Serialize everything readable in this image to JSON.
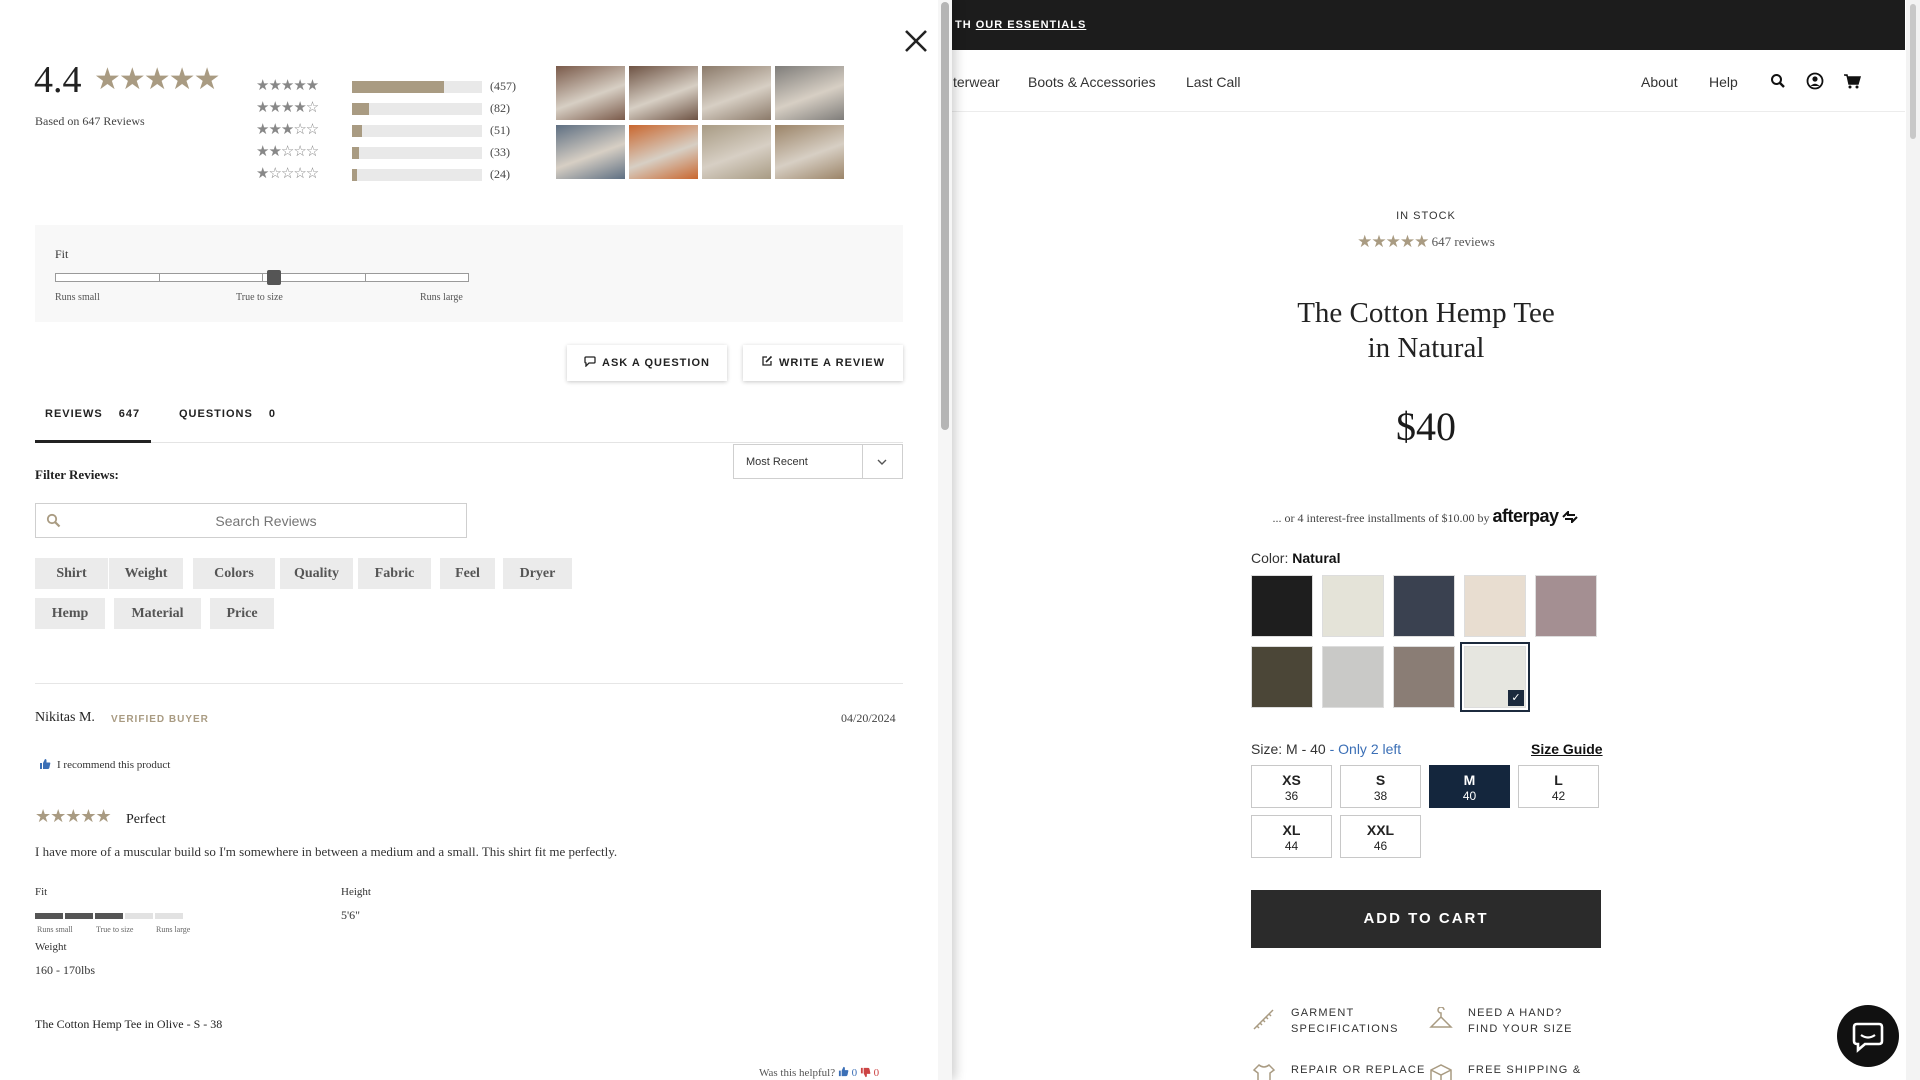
{
  "product_page": {
    "announcement": {
      "text": "TH",
      "link": "OUR ESSENTIALS"
    },
    "nav": {
      "links": [
        "terwear",
        "Boots & Accessories",
        "Last Call"
      ],
      "right_links": [
        "About",
        "Help"
      ],
      "icons": [
        "search-icon",
        "account-icon",
        "cart-icon"
      ]
    },
    "stock_status": "IN STOCK",
    "rating_stars": "★★★★★",
    "review_count_text": "647 reviews",
    "title_line1": "The Cotton Hemp Tee",
    "title_line2": "in Natural",
    "price": "$40",
    "afterpay_text": "... or 4 interest-free installments of $10.00 by",
    "afterpay_brand": "afterpay",
    "color_label": "Color:",
    "color_value": "Natural",
    "swatch_colors": [
      "#1e1e1e",
      "#e4e3d8",
      "#3a4150",
      "#e8ddd0",
      "#a48f92",
      "#4b4637",
      "#c9c9c7",
      "#8a7d75",
      "#e6e6e0"
    ],
    "selected_swatch": 8,
    "size_label": "Size: M - 40",
    "size_stock": "- Only 2 left",
    "size_guide": "Size Guide",
    "sizes": [
      {
        "label": "XS",
        "num": "36"
      },
      {
        "label": "S",
        "num": "38"
      },
      {
        "label": "M",
        "num": "40"
      },
      {
        "label": "L",
        "num": "42"
      },
      {
        "label": "XL",
        "num": "44"
      },
      {
        "label": "XXL",
        "num": "46"
      }
    ],
    "selected_size": 2,
    "add_to_cart": "ADD TO CART",
    "features": [
      {
        "line1": "GARMENT",
        "line2": "SPECIFICATIONS"
      },
      {
        "line1": "NEED A HAND?",
        "line2": "FIND YOUR SIZE"
      },
      {
        "line1": "REPAIR OR REPLACE",
        "line2": ""
      },
      {
        "line1": "FREE SHIPPING &",
        "line2": ""
      }
    ]
  },
  "reviews": {
    "average": "4.4",
    "average_stars": "★★★★★",
    "based_on": "Based on 647 Reviews",
    "distribution": [
      {
        "stars": "★★★★★",
        "count": "(457)",
        "fraction": 0.706
      },
      {
        "stars": "★★★★☆",
        "count": "(82)",
        "fraction": 0.127
      },
      {
        "stars": "★★★☆☆",
        "count": "(51)",
        "fraction": 0.079
      },
      {
        "stars": "★★☆☆☆",
        "count": "(33)",
        "fraction": 0.051
      },
      {
        "stars": "★☆☆☆☆",
        "count": "(24)",
        "fraction": 0.037
      }
    ],
    "photo_colors": [
      "#7a5a4a",
      "#6e5344",
      "#8b7a6a",
      "#7f7d7a",
      "#5e6f82",
      "#c9672f",
      "#a89b84",
      "#9b8468"
    ],
    "fit": {
      "title": "Fit",
      "value": 0.53,
      "labels": [
        "Runs small",
        "True to size",
        "Runs large"
      ]
    },
    "ask_question": "ASK A QUESTION",
    "write_review": "WRITE A REVIEW",
    "tabs": [
      {
        "label": "REVIEWS",
        "count": "647"
      },
      {
        "label": "QUESTIONS",
        "count": "0"
      }
    ],
    "sort": {
      "selected": "Most Recent"
    },
    "filter_title": "Filter Reviews:",
    "search_placeholder": "Search Reviews",
    "chips": [
      "Shirt",
      "Weight",
      "Colors",
      "Quality",
      "Fabric",
      "Feel",
      "Dryer",
      "Hemp",
      "Material",
      "Price"
    ],
    "review": {
      "author": "Nikitas M.",
      "badge": "VERIFIED BUYER",
      "date": "04/20/2024",
      "recommend": "I recommend this product",
      "stars": "★★★★★",
      "title": "Perfect",
      "body": "I have more of a muscular build so I'm somewhere in between a medium and a small. This shirt fit me perfectly.",
      "fit_label": "Fit",
      "fit_filled": 3,
      "fit_total": 5,
      "fit_captions": [
        "Runs small",
        "True to size",
        "Runs large"
      ],
      "height_label": "Height",
      "height_value": "5'6\"",
      "weight_label": "Weight",
      "weight_value": "160 - 170lbs",
      "product": "The Cotton Hemp Tee in Olive - S - 38",
      "helpful_label": "Was this helpful?",
      "helpful_up": "0",
      "helpful_down": "0"
    }
  }
}
